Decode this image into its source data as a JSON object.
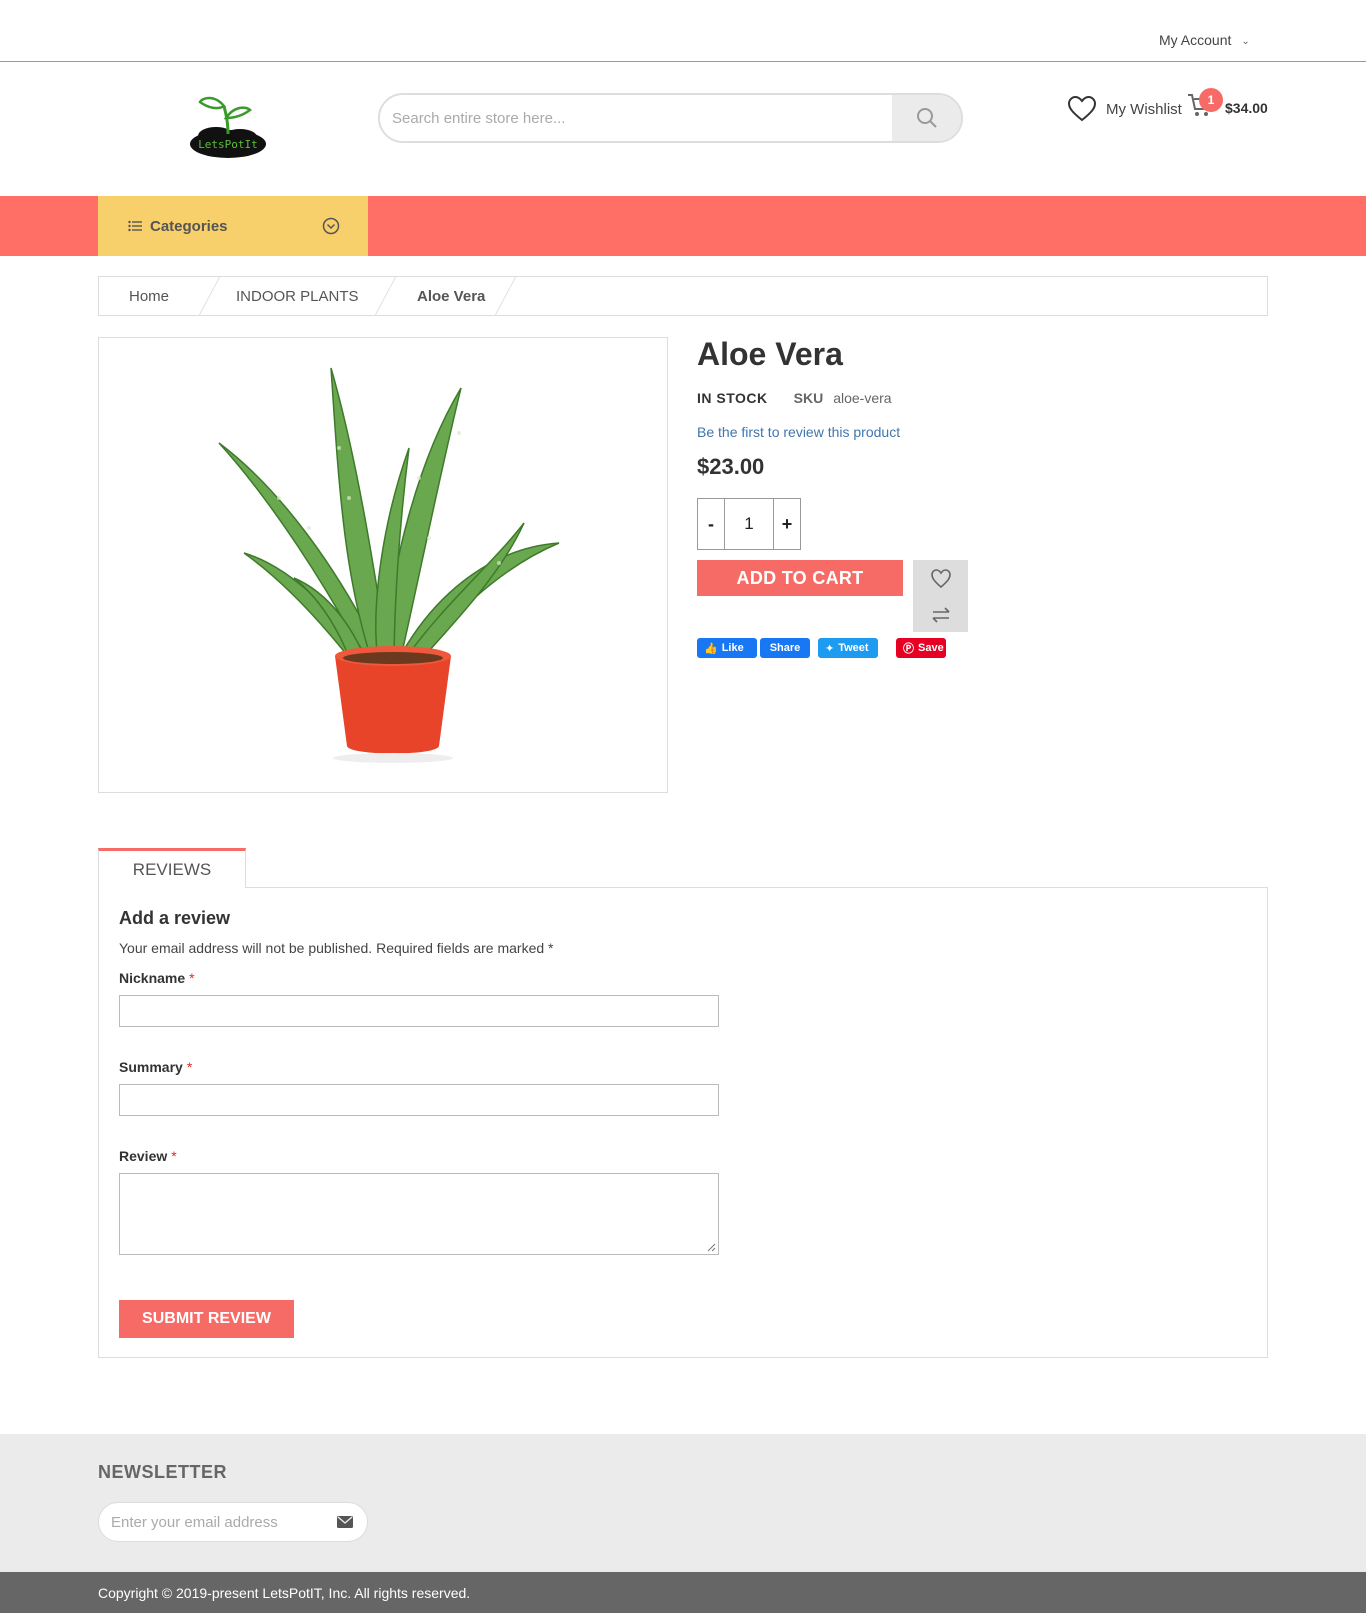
{
  "header": {
    "account_label": "My Account",
    "search_placeholder": "Search entire store here...",
    "wishlist_label": "My Wishlist",
    "cart_count": "1",
    "cart_total": "$34.00",
    "logo_text": "LetsPotIt"
  },
  "nav": {
    "categories_label": "Categories"
  },
  "breadcrumb": {
    "items": [
      "Home",
      "INDOOR PLANTS",
      "Aloe Vera"
    ]
  },
  "product": {
    "name": "Aloe Vera",
    "stock": "IN STOCK",
    "sku_label": "SKU",
    "sku_value": "aloe-vera",
    "review_link": "Be the first to review this product",
    "price": "$23.00",
    "qty_minus": "-",
    "qty_value": "1",
    "qty_plus": "+",
    "add_to_cart": "ADD TO CART",
    "social": {
      "like": "Like",
      "share": "Share",
      "tweet": "Tweet",
      "save": "Save"
    }
  },
  "reviews": {
    "tab_label": "REVIEWS",
    "title": "Add a review",
    "note": "Your email address will not be published. Required fields are marked *",
    "nickname_label": "Nickname",
    "summary_label": "Summary",
    "review_label": "Review",
    "required_mark": "*",
    "submit": "SUBMIT REVIEW"
  },
  "newsletter": {
    "title": "NEWSLETTER",
    "placeholder": "Enter your email address"
  },
  "footer": {
    "copyright": "Copyright © 2019-present LetsPotIT, Inc. All rights reserved."
  },
  "colors": {
    "accent": "#f76b67",
    "nav_bg": "#ff6f66",
    "categories_bg": "#f7cf6b",
    "link": "#3f76ad"
  }
}
